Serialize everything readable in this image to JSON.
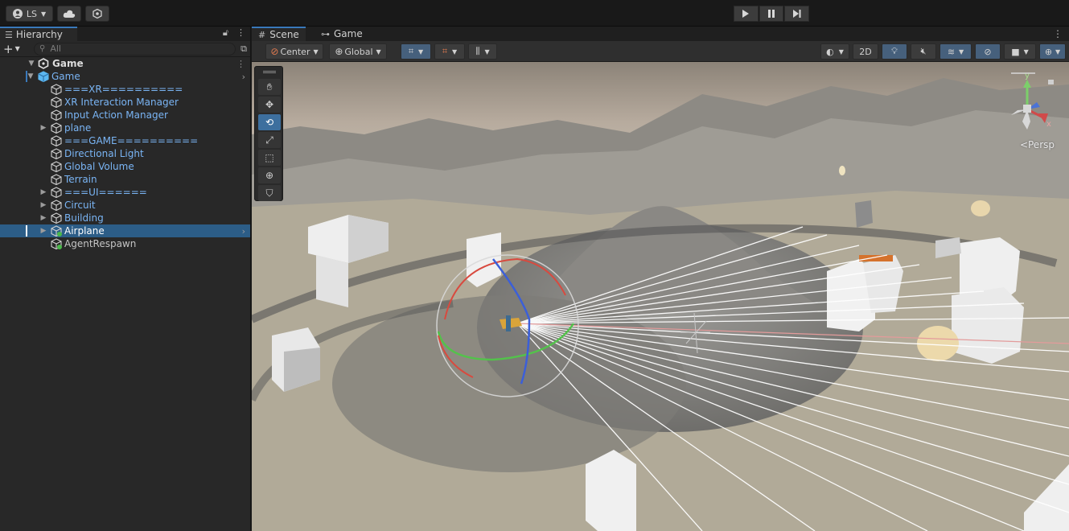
{
  "topbar": {
    "account_label": "LS",
    "play_controls": [
      "play",
      "pause",
      "step"
    ]
  },
  "hierarchy": {
    "tab_label": "Hierarchy",
    "search_placeholder": "All",
    "scene_name": "Game",
    "items": [
      {
        "label": "Game",
        "depth": 1,
        "expanded": true,
        "prefab": true
      },
      {
        "label": "===XR==========",
        "depth": 2,
        "prefab": true
      },
      {
        "label": "XR Interaction Manager",
        "depth": 2,
        "prefab": true
      },
      {
        "label": "Input Action Manager",
        "depth": 2,
        "prefab": true
      },
      {
        "label": "plane",
        "depth": 2,
        "has_children": true,
        "prefab": true
      },
      {
        "label": "===GAME==========",
        "depth": 2,
        "prefab": true
      },
      {
        "label": "Directional Light",
        "depth": 2,
        "prefab": true
      },
      {
        "label": "Global Volume",
        "depth": 2,
        "prefab": true
      },
      {
        "label": "Terrain",
        "depth": 2,
        "prefab": true
      },
      {
        "label": "===UI======",
        "depth": 2,
        "has_children": true,
        "prefab": true
      },
      {
        "label": "Circuit",
        "depth": 2,
        "has_children": true,
        "prefab": true
      },
      {
        "label": "Building",
        "depth": 2,
        "has_children": true,
        "prefab": true
      },
      {
        "label": "Airplane",
        "depth": 2,
        "has_children": true,
        "selected": true
      },
      {
        "label": "AgentRespawn",
        "depth": 2
      }
    ]
  },
  "scene": {
    "tabs": [
      "Scene",
      "Game"
    ],
    "active_tab": "Scene",
    "pivot_mode": "Center",
    "pivot_rotation": "Global",
    "mode_2d_label": "2D",
    "view_label": "Persp",
    "gizmo_axes": [
      "y",
      "x"
    ]
  },
  "colors": {
    "selection": "#2c5d87",
    "prefab_text": "#7ab5f5",
    "accent": "#3a79bb",
    "sky": "#b9b3a8",
    "ground": "#c9c0aa"
  }
}
